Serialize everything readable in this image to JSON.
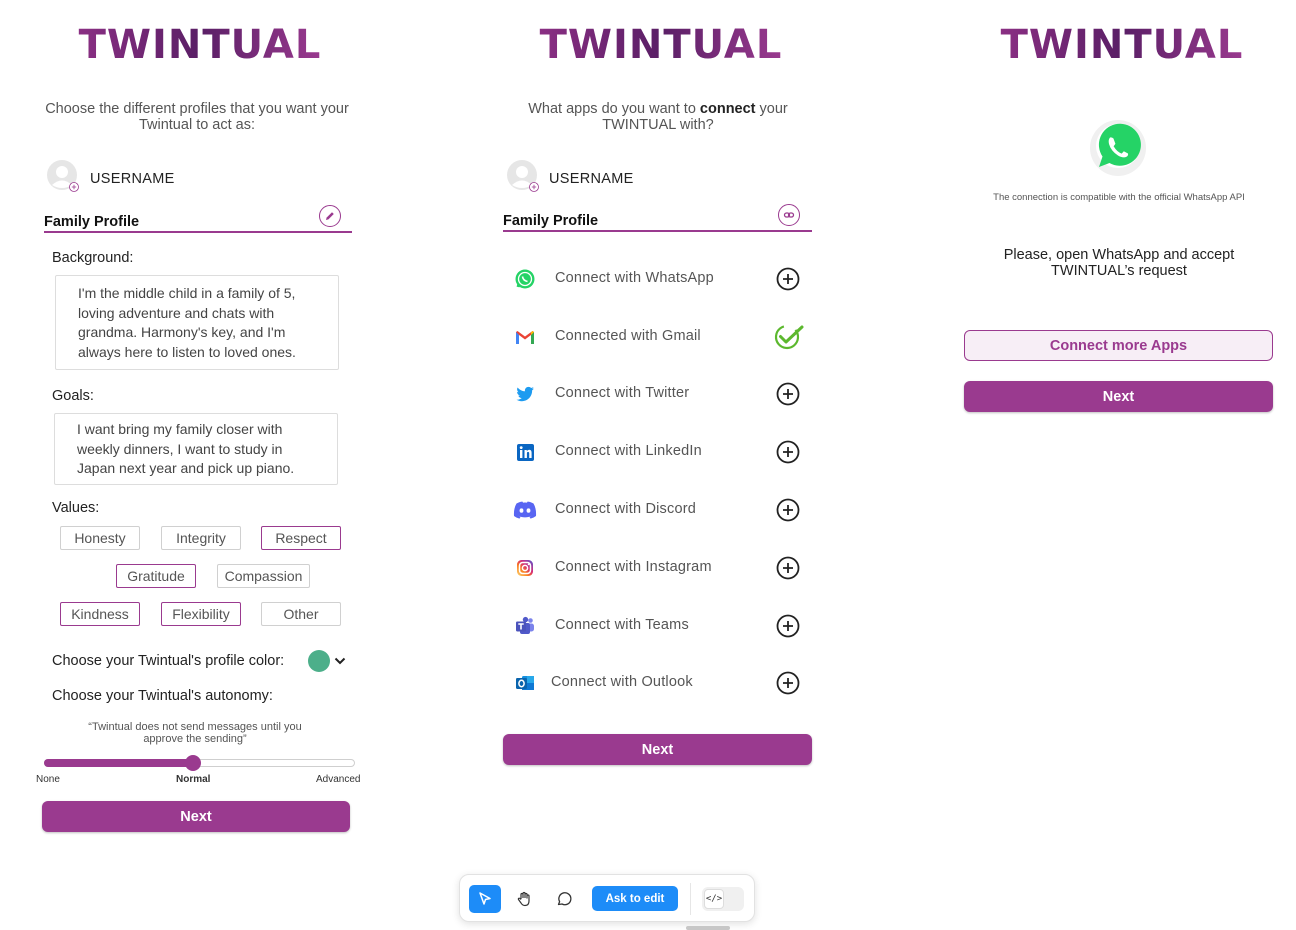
{
  "brand": {
    "logo_text": "TWINTUAL",
    "accent_color": "#9a3a8f",
    "profile_color": "#4caf8a",
    "check_color": "#5cb82e",
    "action_blue": "#1d8cf8"
  },
  "screen1": {
    "prompt": "Choose the different profiles that you want your Twintual to act as:",
    "username": "USERNAME",
    "profile_title": "Family Profile",
    "background_label": "Background:",
    "background_text": "I'm the middle child in a family of 5, loving adventure and chats with grandma. Harmony's key, and I'm always here to listen to loved ones.",
    "goals_label": "Goals:",
    "goals_text": "I want bring my family closer with weekly dinners, I want to study in Japan next year and pick up piano.",
    "values_label": "Values:",
    "values": [
      {
        "label": "Honesty",
        "selected": false
      },
      {
        "label": "Integrity",
        "selected": false
      },
      {
        "label": "Respect",
        "selected": true
      },
      {
        "label": "Gratitude",
        "selected": true
      },
      {
        "label": "Compassion",
        "selected": false
      },
      {
        "label": "Kindness",
        "selected": true
      },
      {
        "label": "Flexibility",
        "selected": true
      },
      {
        "label": "Other",
        "selected": false
      }
    ],
    "color_label": "Choose your Twintual's profile color:",
    "autonomy_label": "Choose your Twintual's autonomy:",
    "autonomy_quote": "“Twintual does not send messages until you approve the sending”",
    "autonomy_levels": [
      "None",
      "Normal",
      "Advanced"
    ],
    "autonomy_selected": "Normal",
    "autonomy_fraction": 0.48,
    "next_label": "Next"
  },
  "screen2": {
    "prompt_pre": "What apps do you want to",
    "prompt_bold": "connect",
    "prompt_post": "your TWINTUAL with?",
    "username": "USERNAME",
    "profile_title": "Family Profile",
    "apps": [
      {
        "name": "Connect with WhatsApp",
        "icon": "whatsapp-icon",
        "connected": false
      },
      {
        "name": "Connected with Gmail",
        "icon": "gmail-icon",
        "connected": true
      },
      {
        "name": "Connect with Twitter",
        "icon": "twitter-icon",
        "connected": false
      },
      {
        "name": "Connect with LinkedIn",
        "icon": "linkedin-icon",
        "connected": false
      },
      {
        "name": "Connect with Discord",
        "icon": "discord-icon",
        "connected": false
      },
      {
        "name": "Connect with Instagram",
        "icon": "instagram-icon",
        "connected": false
      },
      {
        "name": "Connect with Teams",
        "icon": "teams-icon",
        "connected": false
      },
      {
        "name": "Connect with Outlook",
        "icon": "outlook-icon",
        "connected": false
      }
    ],
    "next_label": "Next"
  },
  "screen3": {
    "compat_note": "The connection is compatible with the official WhatsApp API",
    "instruction": "Please, open WhatsApp and accept TWINTUAL’s request",
    "connect_more_label": "Connect more Apps",
    "next_label": "Next"
  },
  "toolbar": {
    "ask_label": "Ask to edit",
    "code_label": "</>",
    "tools": [
      "pointer-icon",
      "hand-icon",
      "comment-icon"
    ]
  }
}
